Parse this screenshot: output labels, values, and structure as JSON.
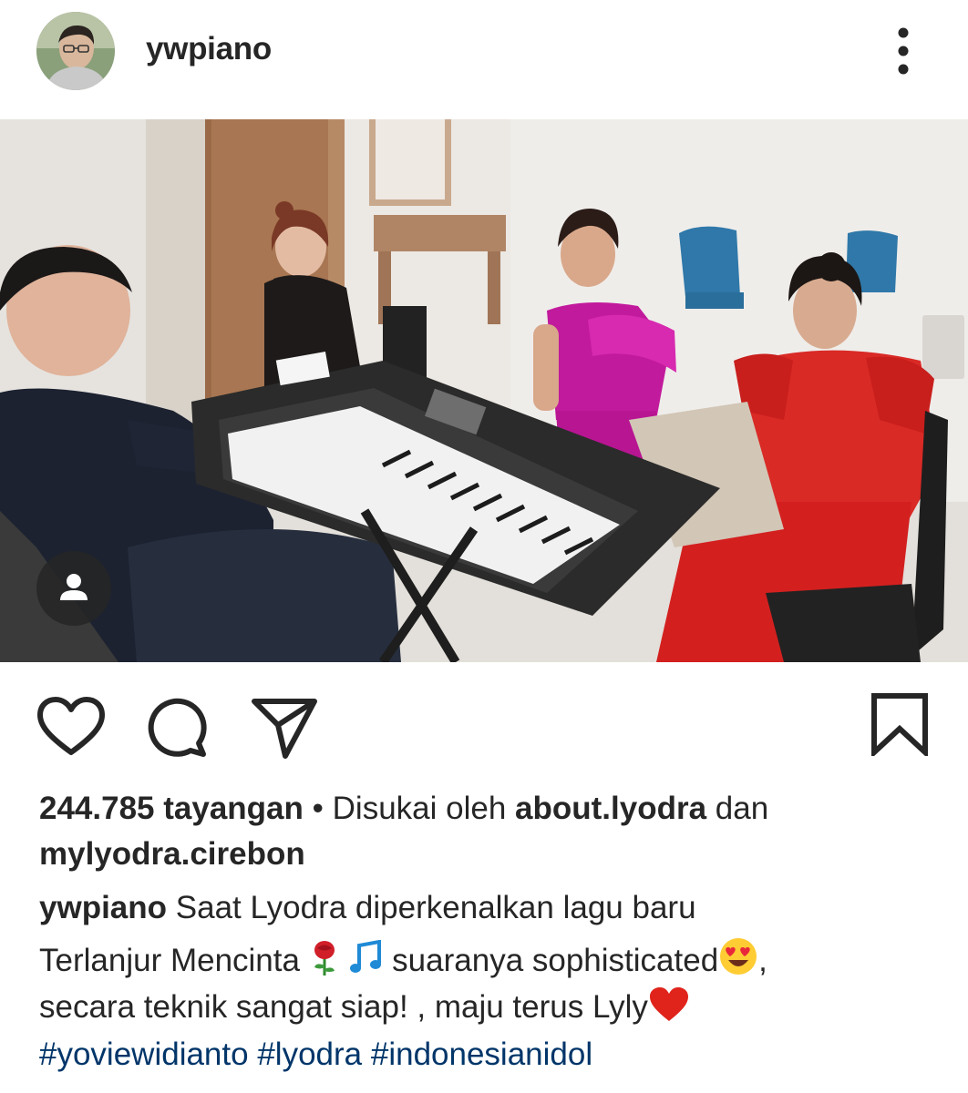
{
  "post": {
    "username": "ywpiano",
    "views": "244.785 tayangan",
    "separator": "•",
    "liked_by_prefix": "Disukai oleh",
    "liked_by_user1": "about.lyodra",
    "liked_by_and": "dan",
    "liked_by_user2": "mylyodra.cirebon",
    "caption_author": "ywpiano",
    "caption_line1": "Saat Lyodra diperkenalkan lagu baru",
    "caption_line2a": "Terlanjur Mencinta",
    "caption_line2b": "suaranya sophisticated",
    "caption_line2c": ",",
    "caption_line3": "secara teknik sangat siap! , maju terus Lyly",
    "hashtags": [
      "#yoviewidianto",
      "#lyodra",
      "#indonesianidol"
    ]
  },
  "icons": {
    "more": "more-vertical-icon",
    "like": "heart-outline-icon",
    "comment": "comment-bubble-icon",
    "share": "paper-plane-icon",
    "save": "bookmark-outline-icon",
    "tagged": "user-tag-icon",
    "emoji_rose": "rose-emoji",
    "emoji_music": "music-note-emoji",
    "emoji_heart_eyes": "heart-eyes-emoji",
    "emoji_heart": "red-heart-emoji"
  },
  "colors": {
    "text": "#262626",
    "hashtag": "#003569",
    "tag_badge": "#262626"
  }
}
